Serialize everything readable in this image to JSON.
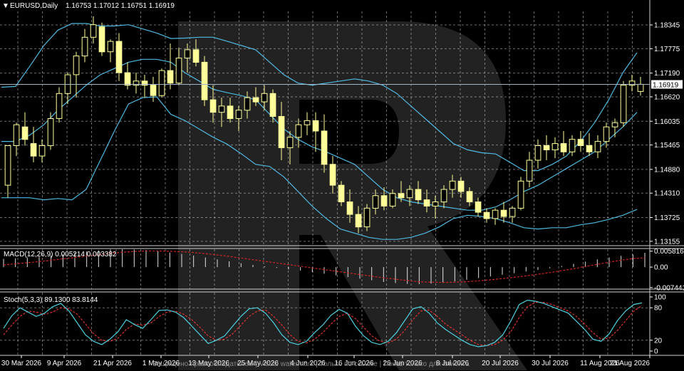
{
  "header": {
    "symbol_label": "EURUSD,Daily",
    "ohlc_label": "1.16753 1.17012 1.16751 1.16919",
    "macd_label": "MACD(12,26,9) 0.005214 0.003382",
    "stoch_label": "Stoch(5,3,3) 89.1300 83.8144",
    "watermark_text": "Защищено правообладателем | Visual watermark | Только по ссылке | Показ только для клиента"
  },
  "colors": {
    "background": "#000000",
    "grid": "#c8c8c8",
    "candle_bull_fill": "#000000",
    "candle_bear_fill": "#ffff99",
    "candle_outline": "#ffff99",
    "bollinger": "#4fb8e0",
    "macd_hist": "#e0e0e0",
    "macd_signal": "#cc2222",
    "stoch_main": "#4fd0e0",
    "stoch_signal": "#ee3333",
    "price_line": "#9fb6c8",
    "price_tag_bg": "#ffffff",
    "price_tag_text": "#000000"
  },
  "chart_data": [
    {
      "type": "candlestick",
      "title": "EURUSD,Daily",
      "x_ticks": [
        "30 Mar 2026",
        "9 Apr 2026",
        "21 Apr 2026",
        "1 May 2026",
        "13 May 2026",
        "25 May 2026",
        "4 Jun 2026",
        "16 Jun 2026",
        "26 Jun 2026",
        "8 Jul 2026",
        "20 Jul 2026",
        "30 Jul 2026",
        "11 Aug 2026",
        "21 Aug 2026"
      ],
      "y_ticks": [
        1.18345,
        1.17775,
        1.1719,
        1.1662,
        1.16035,
        1.15465,
        1.1488,
        1.1431,
        1.13725,
        1.13155
      ],
      "ylim": [
        1.1305,
        1.1867
      ],
      "current_price": 1.16919,
      "current_price_label": "1.16919",
      "grid": true,
      "indicators": [
        "Bollinger Bands"
      ],
      "upper_band_y": [
        1.1685,
        1.1687,
        1.1735,
        1.1785,
        1.1822,
        1.1838,
        1.1838,
        1.1832,
        1.1832,
        1.1835,
        1.1825,
        1.1815,
        1.1802,
        1.1803,
        1.1805,
        1.1805,
        1.1795,
        1.1785,
        1.1775,
        1.1745,
        1.1715,
        1.1695,
        1.169,
        1.1695,
        1.17,
        1.1705,
        1.17,
        1.169,
        1.167,
        1.164,
        1.161,
        1.158,
        1.155,
        1.1535,
        1.1528,
        1.1525,
        1.1505,
        1.1485,
        1.1485,
        1.15,
        1.152,
        1.1555,
        1.16,
        1.1655,
        1.172,
        1.1768
      ],
      "middle_band_y": [
        1.1555,
        1.1555,
        1.157,
        1.1595,
        1.163,
        1.166,
        1.169,
        1.1715,
        1.173,
        1.1745,
        1.1752,
        1.1752,
        1.1745,
        1.172,
        1.17,
        1.168,
        1.1672,
        1.1665,
        1.1655,
        1.162,
        1.1585,
        1.156,
        1.1542,
        1.153,
        1.1515,
        1.15,
        1.147,
        1.144,
        1.142,
        1.141,
        1.1405,
        1.14,
        1.1395,
        1.139,
        1.139,
        1.1398,
        1.1415,
        1.1435,
        1.145,
        1.147,
        1.149,
        1.151,
        1.153,
        1.156,
        1.159,
        1.1625
      ],
      "lower_band_y": [
        1.142,
        1.142,
        1.142,
        1.1415,
        1.1418,
        1.1415,
        1.144,
        1.151,
        1.158,
        1.1645,
        1.166,
        1.1662,
        1.162,
        1.1605,
        1.1585,
        1.1565,
        1.1548,
        1.1525,
        1.15,
        1.1495,
        1.147,
        1.1435,
        1.14,
        1.137,
        1.1345,
        1.1335,
        1.1325,
        1.132,
        1.132,
        1.1325,
        1.1335,
        1.135,
        1.137,
        1.1378,
        1.1375,
        1.137,
        1.136,
        1.1348,
        1.1345,
        1.1348,
        1.1348,
        1.1355,
        1.136,
        1.1368,
        1.1378,
        1.1392
      ],
      "candles": [
        {
          "o": 1.145,
          "h": 1.1485,
          "l": 1.142,
          "c": 1.1545
        },
        {
          "o": 1.1545,
          "h": 1.16,
          "l": 1.152,
          "c": 1.1595
        },
        {
          "o": 1.159,
          "h": 1.1625,
          "l": 1.1545,
          "c": 1.156
        },
        {
          "o": 1.155,
          "h": 1.159,
          "l": 1.1505,
          "c": 1.152
        },
        {
          "o": 1.152,
          "h": 1.156,
          "l": 1.1505,
          "c": 1.1545
        },
        {
          "o": 1.1545,
          "h": 1.1625,
          "l": 1.1535,
          "c": 1.161
        },
        {
          "o": 1.161,
          "h": 1.1685,
          "l": 1.16,
          "c": 1.167
        },
        {
          "o": 1.167,
          "h": 1.172,
          "l": 1.1645,
          "c": 1.1715
        },
        {
          "o": 1.1715,
          "h": 1.177,
          "l": 1.166,
          "c": 1.176
        },
        {
          "o": 1.176,
          "h": 1.1825,
          "l": 1.1745,
          "c": 1.1805
        },
        {
          "o": 1.1805,
          "h": 1.1855,
          "l": 1.179,
          "c": 1.1835
        },
        {
          "o": 1.183,
          "h": 1.184,
          "l": 1.176,
          "c": 1.177
        },
        {
          "o": 1.177,
          "h": 1.18,
          "l": 1.1745,
          "c": 1.1795
        },
        {
          "o": 1.1795,
          "h": 1.1815,
          "l": 1.17,
          "c": 1.172
        },
        {
          "o": 1.172,
          "h": 1.1745,
          "l": 1.168,
          "c": 1.169
        },
        {
          "o": 1.169,
          "h": 1.172,
          "l": 1.167,
          "c": 1.17
        },
        {
          "o": 1.17,
          "h": 1.1715,
          "l": 1.166,
          "c": 1.169
        },
        {
          "o": 1.169,
          "h": 1.171,
          "l": 1.165,
          "c": 1.1665
        },
        {
          "o": 1.1665,
          "h": 1.173,
          "l": 1.166,
          "c": 1.1725
        },
        {
          "o": 1.1725,
          "h": 1.179,
          "l": 1.168,
          "c": 1.1695
        },
        {
          "o": 1.1695,
          "h": 1.178,
          "l": 1.169,
          "c": 1.1755
        },
        {
          "o": 1.1755,
          "h": 1.179,
          "l": 1.172,
          "c": 1.1775
        },
        {
          "o": 1.1775,
          "h": 1.18,
          "l": 1.1735,
          "c": 1.1745
        },
        {
          "o": 1.1745,
          "h": 1.176,
          "l": 1.164,
          "c": 1.1655
        },
        {
          "o": 1.1655,
          "h": 1.169,
          "l": 1.16,
          "c": 1.1625
        },
        {
          "o": 1.1625,
          "h": 1.166,
          "l": 1.159,
          "c": 1.164
        },
        {
          "o": 1.164,
          "h": 1.166,
          "l": 1.16,
          "c": 1.161
        },
        {
          "o": 1.161,
          "h": 1.164,
          "l": 1.158,
          "c": 1.163
        },
        {
          "o": 1.163,
          "h": 1.1675,
          "l": 1.161,
          "c": 1.166
        },
        {
          "o": 1.166,
          "h": 1.1685,
          "l": 1.164,
          "c": 1.165
        },
        {
          "o": 1.165,
          "h": 1.169,
          "l": 1.163,
          "c": 1.167
        },
        {
          "o": 1.167,
          "h": 1.168,
          "l": 1.16,
          "c": 1.1615
        },
        {
          "o": 1.1615,
          "h": 1.165,
          "l": 1.151,
          "c": 1.154
        },
        {
          "o": 1.154,
          "h": 1.158,
          "l": 1.15,
          "c": 1.1565
        },
        {
          "o": 1.1565,
          "h": 1.161,
          "l": 1.154,
          "c": 1.1595
        },
        {
          "o": 1.1595,
          "h": 1.1625,
          "l": 1.157,
          "c": 1.1605
        },
        {
          "o": 1.1605,
          "h": 1.1625,
          "l": 1.153,
          "c": 1.158
        },
        {
          "o": 1.158,
          "h": 1.162,
          "l": 1.148,
          "c": 1.15
        },
        {
          "o": 1.15,
          "h": 1.152,
          "l": 1.143,
          "c": 1.145
        },
        {
          "o": 1.145,
          "h": 1.146,
          "l": 1.14,
          "c": 1.141
        },
        {
          "o": 1.141,
          "h": 1.144,
          "l": 1.136,
          "c": 1.138
        },
        {
          "o": 1.138,
          "h": 1.14,
          "l": 1.1335,
          "c": 1.135
        },
        {
          "o": 1.135,
          "h": 1.1405,
          "l": 1.134,
          "c": 1.1395
        },
        {
          "o": 1.1395,
          "h": 1.144,
          "l": 1.138,
          "c": 1.1425
        },
        {
          "o": 1.1425,
          "h": 1.1445,
          "l": 1.139,
          "c": 1.14
        },
        {
          "o": 1.14,
          "h": 1.144,
          "l": 1.1395,
          "c": 1.143
        },
        {
          "o": 1.143,
          "h": 1.146,
          "l": 1.141,
          "c": 1.142
        },
        {
          "o": 1.142,
          "h": 1.145,
          "l": 1.14,
          "c": 1.144
        },
        {
          "o": 1.144,
          "h": 1.146,
          "l": 1.1405,
          "c": 1.1415
        },
        {
          "o": 1.1415,
          "h": 1.144,
          "l": 1.1385,
          "c": 1.14
        },
        {
          "o": 1.14,
          "h": 1.1425,
          "l": 1.137,
          "c": 1.141
        },
        {
          "o": 1.141,
          "h": 1.145,
          "l": 1.1395,
          "c": 1.144
        },
        {
          "o": 1.144,
          "h": 1.1475,
          "l": 1.142,
          "c": 1.146
        },
        {
          "o": 1.146,
          "h": 1.147,
          "l": 1.142,
          "c": 1.1435
        },
        {
          "o": 1.1435,
          "h": 1.1445,
          "l": 1.14,
          "c": 1.141
        },
        {
          "o": 1.141,
          "h": 1.142,
          "l": 1.1375,
          "c": 1.1385
        },
        {
          "o": 1.1385,
          "h": 1.1395,
          "l": 1.136,
          "c": 1.137
        },
        {
          "o": 1.137,
          "h": 1.1395,
          "l": 1.1355,
          "c": 1.139
        },
        {
          "o": 1.139,
          "h": 1.141,
          "l": 1.136,
          "c": 1.1375
        },
        {
          "o": 1.1375,
          "h": 1.14,
          "l": 1.136,
          "c": 1.1395
        },
        {
          "o": 1.1395,
          "h": 1.147,
          "l": 1.139,
          "c": 1.146
        },
        {
          "o": 1.146,
          "h": 1.153,
          "l": 1.1445,
          "c": 1.151
        },
        {
          "o": 1.151,
          "h": 1.156,
          "l": 1.149,
          "c": 1.1545
        },
        {
          "o": 1.1545,
          "h": 1.157,
          "l": 1.151,
          "c": 1.1535
        },
        {
          "o": 1.1535,
          "h": 1.1565,
          "l": 1.1515,
          "c": 1.155
        },
        {
          "o": 1.155,
          "h": 1.158,
          "l": 1.152,
          "c": 1.153
        },
        {
          "o": 1.153,
          "h": 1.157,
          "l": 1.152,
          "c": 1.156
        },
        {
          "o": 1.156,
          "h": 1.158,
          "l": 1.153,
          "c": 1.1545
        },
        {
          "o": 1.1545,
          "h": 1.1575,
          "l": 1.152,
          "c": 1.153
        },
        {
          "o": 1.153,
          "h": 1.157,
          "l": 1.1515,
          "c": 1.1555
        },
        {
          "o": 1.1555,
          "h": 1.16,
          "l": 1.154,
          "c": 1.159
        },
        {
          "o": 1.159,
          "h": 1.161,
          "l": 1.1565,
          "c": 1.16
        },
        {
          "o": 1.16,
          "h": 1.17,
          "l": 1.159,
          "c": 1.169
        },
        {
          "o": 1.169,
          "h": 1.1715,
          "l": 1.1675,
          "c": 1.17
        },
        {
          "o": 1.1675,
          "h": 1.171,
          "l": 1.1665,
          "c": 1.1692
        }
      ]
    },
    {
      "type": "bar",
      "title": "MACD(12,26,9) 0.005214 0.003382",
      "y_ticks": [
        0.005816,
        0.0,
        -0.007441
      ],
      "y_tick_labels": [
        "0.005816",
        "0.00",
        "-0.007441"
      ],
      "ylim": [
        -0.008,
        0.0065
      ],
      "series": [
        {
          "name": "MACD",
          "values": [
            0.003,
            0.0032,
            0.0035,
            0.0038,
            0.0042,
            0.0047,
            0.0052,
            0.0057,
            0.0061,
            0.0064,
            0.0065,
            0.0064,
            0.0062,
            0.0058,
            0.0053,
            0.0048,
            0.0042,
            0.0035,
            0.0028,
            0.0021,
            0.0014,
            0.0008,
            0.0003,
            -0.0003,
            -0.0008,
            -0.0013,
            -0.0018,
            -0.0024,
            -0.003,
            -0.0036,
            -0.0042,
            -0.0048,
            -0.0054,
            -0.0058,
            -0.0061,
            -0.0062,
            -0.006,
            -0.0057,
            -0.0052,
            -0.0046,
            -0.004,
            -0.0034,
            -0.0028,
            -0.0022,
            -0.0016,
            -0.001,
            -0.0004,
            0.0004,
            0.0012,
            0.002,
            0.0028,
            0.0035,
            0.0041,
            0.0046,
            0.0052
          ]
        },
        {
          "name": "Signal",
          "values": [
            0.0008,
            0.0012,
            0.0016,
            0.002,
            0.0025,
            0.003,
            0.0035,
            0.004,
            0.0045,
            0.005,
            0.0054,
            0.0057,
            0.0059,
            0.0059,
            0.0058,
            0.0056,
            0.0053,
            0.0049,
            0.0044,
            0.0039,
            0.0033,
            0.0027,
            0.0021,
            0.0015,
            0.0009,
            0.0003,
            -0.0003,
            -0.0009,
            -0.0015,
            -0.0021,
            -0.0027,
            -0.0033,
            -0.0039,
            -0.0044,
            -0.0049,
            -0.0053,
            -0.0055,
            -0.0056,
            -0.0055,
            -0.0053,
            -0.005,
            -0.0046,
            -0.0042,
            -0.0037,
            -0.0032,
            -0.0026,
            -0.002,
            -0.0013,
            -0.0006,
            0.0002,
            0.001,
            0.0018,
            0.0025,
            0.0031,
            0.0034
          ]
        }
      ]
    },
    {
      "type": "line",
      "title": "Stoch(5,3,3) 89.1300 83.8144",
      "y_ticks": [
        100,
        80,
        20,
        0
      ],
      "ylim": [
        0,
        100
      ],
      "series": [
        {
          "name": "Main",
          "values": [
            42,
            65,
            80,
            72,
            64,
            70,
            82,
            88,
            74,
            52,
            30,
            18,
            12,
            22,
            36,
            58,
            49,
            42,
            58,
            75,
            76,
            72,
            62,
            46,
            30,
            14,
            20,
            28,
            46,
            64,
            78,
            80,
            70,
            52,
            30,
            16,
            12,
            18,
            34,
            48,
            66,
            77,
            70,
            46,
            28,
            16,
            12,
            18,
            34,
            56,
            78,
            82,
            70,
            52,
            40,
            30,
            20,
            12,
            8,
            10,
            16,
            30,
            56,
            86,
            94,
            92,
            88,
            82,
            76,
            70,
            55,
            40,
            22,
            18,
            32,
            56,
            74,
            86,
            89
          ]
        },
        {
          "name": "Signal",
          "values": [
            30,
            48,
            64,
            74,
            72,
            68,
            72,
            80,
            78,
            68,
            50,
            32,
            20,
            18,
            24,
            40,
            50,
            48,
            52,
            64,
            72,
            74,
            68,
            58,
            44,
            28,
            20,
            22,
            32,
            48,
            64,
            74,
            76,
            64,
            48,
            30,
            18,
            15,
            22,
            34,
            50,
            64,
            70,
            60,
            44,
            28,
            18,
            15,
            22,
            38,
            58,
            74,
            76,
            64,
            50,
            40,
            30,
            20,
            12,
            10,
            12,
            20,
            36,
            62,
            82,
            90,
            90,
            86,
            80,
            74,
            64,
            50,
            34,
            22,
            24,
            38,
            56,
            74,
            84
          ]
        }
      ]
    }
  ]
}
